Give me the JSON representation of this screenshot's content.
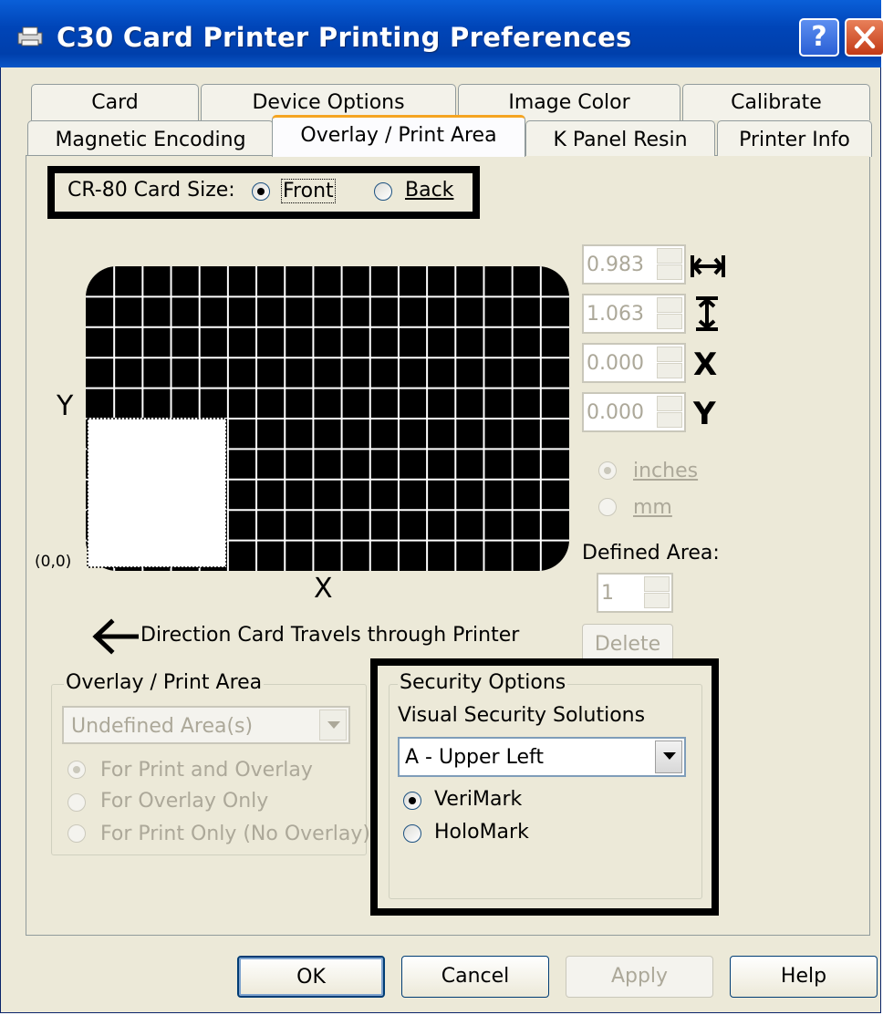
{
  "window": {
    "title": "C30 Card Printer Printing Preferences",
    "help_label": "?"
  },
  "tabs": {
    "row1": [
      "Card",
      "Device Options",
      "Image Color",
      "Calibrate"
    ],
    "row2": [
      "Magnetic Encoding",
      "Overlay / Print Area",
      "K Panel Resin",
      "Printer Info"
    ],
    "active": "Overlay / Print Area"
  },
  "card_size": {
    "label": "CR-80 Card Size:",
    "front": "Front",
    "back": "Back",
    "selected": "Front"
  },
  "diagram": {
    "y_label": "Y",
    "x_label": "X",
    "origin_label": "(0,0)",
    "direction_text": "Direction Card Travels through Printer"
  },
  "dimensions": {
    "width": "0.983",
    "height": "1.063",
    "x": "0.000",
    "y": "0.000",
    "x_label": "X",
    "y_label": "Y",
    "icons": [
      "horizontal-width-icon",
      "vertical-height-icon"
    ]
  },
  "units": {
    "inches": "inches",
    "mm": "mm",
    "selected": "inches"
  },
  "defined_area": {
    "label": "Defined Area:",
    "value": "1",
    "delete_label": "Delete"
  },
  "overlay_group": {
    "legend": "Overlay / Print Area",
    "combo_value": "Undefined Area(s)",
    "options": [
      "For Print and Overlay",
      "For Overlay Only",
      "For Print Only (No Overlay)"
    ],
    "selected": "For Print and Overlay"
  },
  "security_group": {
    "legend": "Security Options",
    "subtitle": "Visual Security Solutions",
    "combo_value": "A - Upper Left",
    "options": [
      "VeriMark",
      "HoloMark"
    ],
    "selected": "VeriMark"
  },
  "buttons": {
    "ok": "OK",
    "cancel": "Cancel",
    "apply": "Apply",
    "help": "Help"
  }
}
